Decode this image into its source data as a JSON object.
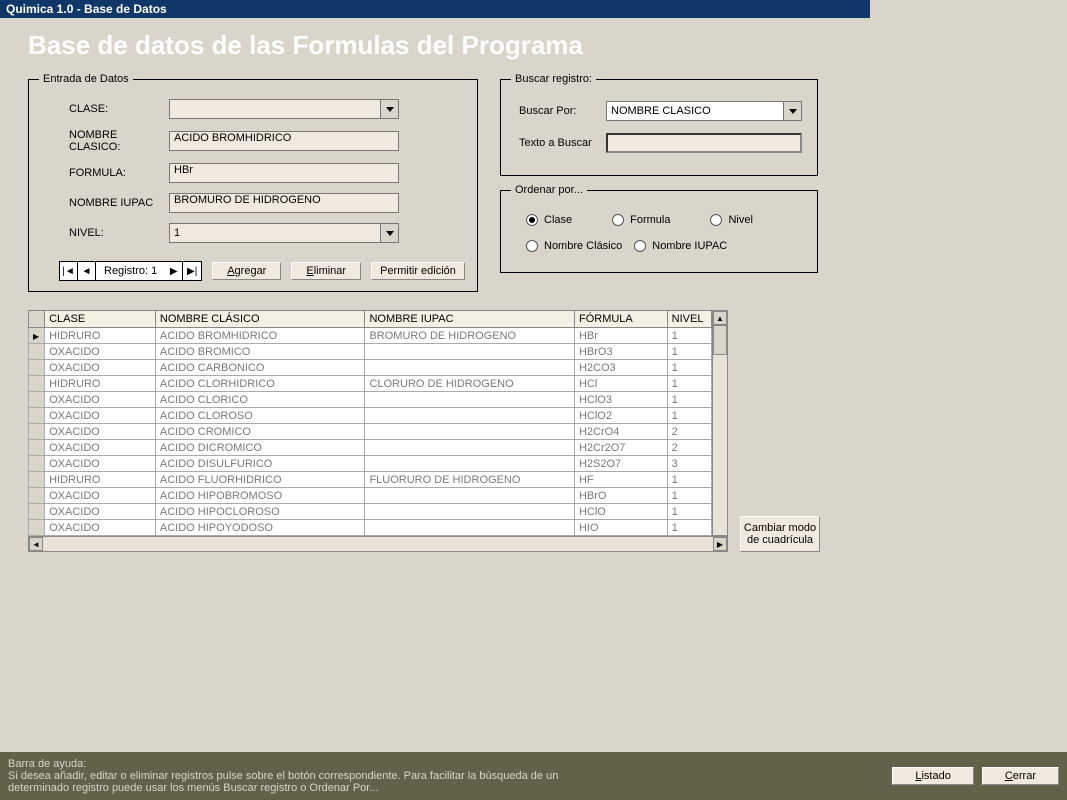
{
  "titlebar": "Quimica 1.0 - Base de Datos",
  "main_title": "Base de datos de las Formulas del Programa",
  "entry": {
    "legend": "Entrada de Datos",
    "labels": {
      "clase": "CLASE:",
      "nombre": "NOMBRE CLASICO:",
      "formula": "FORMULA:",
      "iupac": "NOMBRE IUPAC",
      "nivel": "NIVEL:"
    },
    "values": {
      "clase": "",
      "nombre": "ACIDO BROMHIDRICO",
      "formula": "HBr",
      "iupac": "BROMURO DE HIDROGENO",
      "nivel": "1"
    },
    "nav_label": "Registro: 1",
    "btn_add": "Agregar",
    "btn_del": "Eliminar",
    "btn_edit": "Permitir edición"
  },
  "search": {
    "legend": "Buscar registro:",
    "by_label": "Buscar Por:",
    "by_value": "NOMBRE CLASICO",
    "text_label": "Texto a Buscar",
    "text_value": ""
  },
  "order": {
    "legend": "Ordenar por...",
    "options": {
      "clase": "Clase",
      "formula": "Formula",
      "nivel": "Nivel",
      "nombre": "Nombre Clásico",
      "iupac": "Nombre IUPAC"
    },
    "selected": "clase"
  },
  "table": {
    "headers": {
      "clase": "CLASE",
      "nombre": "NOMBRE CLÁSICO",
      "iupac": "NOMBRE IUPAC",
      "formula": "FÓRMULA",
      "nivel": "NIVEL"
    },
    "rows": [
      {
        "clase": "HIDRURO",
        "nombre": "ACIDO BROMHIDRICO",
        "iupac": "BROMURO DE HIDROGENO",
        "formula": "HBr",
        "nivel": "1"
      },
      {
        "clase": "OXACIDO",
        "nombre": "ACIDO BROMICO",
        "iupac": "",
        "formula": "HBrO3",
        "nivel": "1"
      },
      {
        "clase": "OXACIDO",
        "nombre": "ACIDO CARBONICO",
        "iupac": "",
        "formula": "H2CO3",
        "nivel": "1"
      },
      {
        "clase": "HIDRURO",
        "nombre": "ACIDO CLORHIDRICO",
        "iupac": "CLORURO DE HIDROGENO",
        "formula": "HCl",
        "nivel": "1"
      },
      {
        "clase": "OXACIDO",
        "nombre": "ACIDO CLORICO",
        "iupac": "",
        "formula": "HClO3",
        "nivel": "1"
      },
      {
        "clase": "OXACIDO",
        "nombre": "ACIDO CLOROSO",
        "iupac": "",
        "formula": "HClO2",
        "nivel": "1"
      },
      {
        "clase": "OXACIDO",
        "nombre": "ACIDO CROMICO",
        "iupac": "",
        "formula": "H2CrO4",
        "nivel": "2"
      },
      {
        "clase": "OXACIDO",
        "nombre": "ACIDO DICROMICO",
        "iupac": "",
        "formula": "H2Cr2O7",
        "nivel": "2"
      },
      {
        "clase": "OXACIDO",
        "nombre": "ACIDO DISULFURICO",
        "iupac": "",
        "formula": "H2S2O7",
        "nivel": "3"
      },
      {
        "clase": "HIDRURO",
        "nombre": "ACIDO FLUORHIDRICO",
        "iupac": "FLUORURO DE HIDROGENO",
        "formula": "HF",
        "nivel": "1"
      },
      {
        "clase": "OXACIDO",
        "nombre": "ACIDO HIPOBROMOSO",
        "iupac": "",
        "formula": "HBrO",
        "nivel": "1"
      },
      {
        "clase": "OXACIDO",
        "nombre": "ACIDO HIPOCLOROSO",
        "iupac": "",
        "formula": "HClO",
        "nivel": "1"
      },
      {
        "clase": "OXACIDO",
        "nombre": "ACIDO HIPOYODOSO",
        "iupac": "",
        "formula": "HIO",
        "nivel": "1"
      }
    ]
  },
  "mode_btn": "Cambiar modo de cuadrícula",
  "status": {
    "title": "Barra de ayuda:",
    "text": "Si desea añadir, editar o eliminar registros pulse sobre el botón correspondiente. Para facilitar la búsqueda de un determinado registro puede usar los menús Buscar registro o Ordenar Por...",
    "btn_list": "Listado",
    "btn_close": "Cerrar"
  }
}
